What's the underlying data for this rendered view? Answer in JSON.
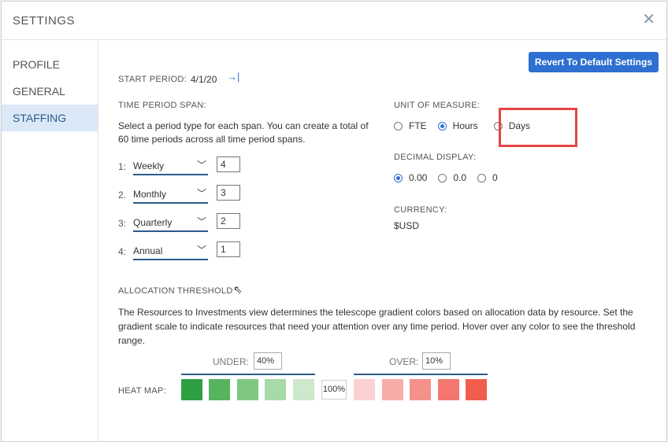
{
  "dialog": {
    "title": "SETTINGS",
    "close_icon": "close-icon"
  },
  "sidebar": {
    "items": [
      {
        "label": "PROFILE",
        "active": false
      },
      {
        "label": "GENERAL",
        "active": false
      },
      {
        "label": "STAFFING",
        "active": true
      }
    ]
  },
  "actions": {
    "revert_label": "Revert To Default Settings"
  },
  "start_period": {
    "label": "START PERIOD:",
    "value": "4/1/20",
    "icon": "arrow-right-bar-icon"
  },
  "time_span": {
    "label": "TIME PERIOD SPAN:",
    "description": "Select a period type for each span. You can create a total of 60 time periods across all time period spans.",
    "periods": [
      {
        "num": "1:",
        "type": "Weekly",
        "count": "4"
      },
      {
        "num": "2.",
        "type": "Monthly",
        "count": "3"
      },
      {
        "num": "3:",
        "type": "Quarterly",
        "count": "2"
      },
      {
        "num": "4:",
        "type": "Annual",
        "count": "1"
      }
    ]
  },
  "unit_of_measure": {
    "label": "UNIT OF MEASURE:",
    "options": [
      "FTE",
      "Hours",
      "Days"
    ],
    "selected": "Hours"
  },
  "decimal_display": {
    "label": "DECIMAL DISPLAY:",
    "options": [
      "0.00",
      "0.0",
      "0"
    ],
    "selected": "0.00"
  },
  "currency": {
    "label": "CURRENCY:",
    "value": "$USD"
  },
  "allocation": {
    "label": "ALLOCATION THRESHOLD",
    "description": "The Resources to Investments view determines the telescope gradient colors based on allocation data by resource. Set the gradient scale to indicate resources that need your attention over any time period. Hover over any color to see the threshold range.",
    "under_label": "UNDER:",
    "under_value": "40%",
    "over_label": "OVER:",
    "over_value": "10%",
    "heat_label": "HEAT MAP:",
    "center_value": "100%",
    "under_colors": [
      "#2ea043",
      "#58b35f",
      "#80c782",
      "#a8d9a8",
      "#cde8cc"
    ],
    "over_colors": [
      "#fbd2d0",
      "#f7aca7",
      "#f4918a",
      "#f3776e",
      "#f15d4d"
    ]
  },
  "highlight_color": "#e44444",
  "accent_color": "#2e6fd1"
}
